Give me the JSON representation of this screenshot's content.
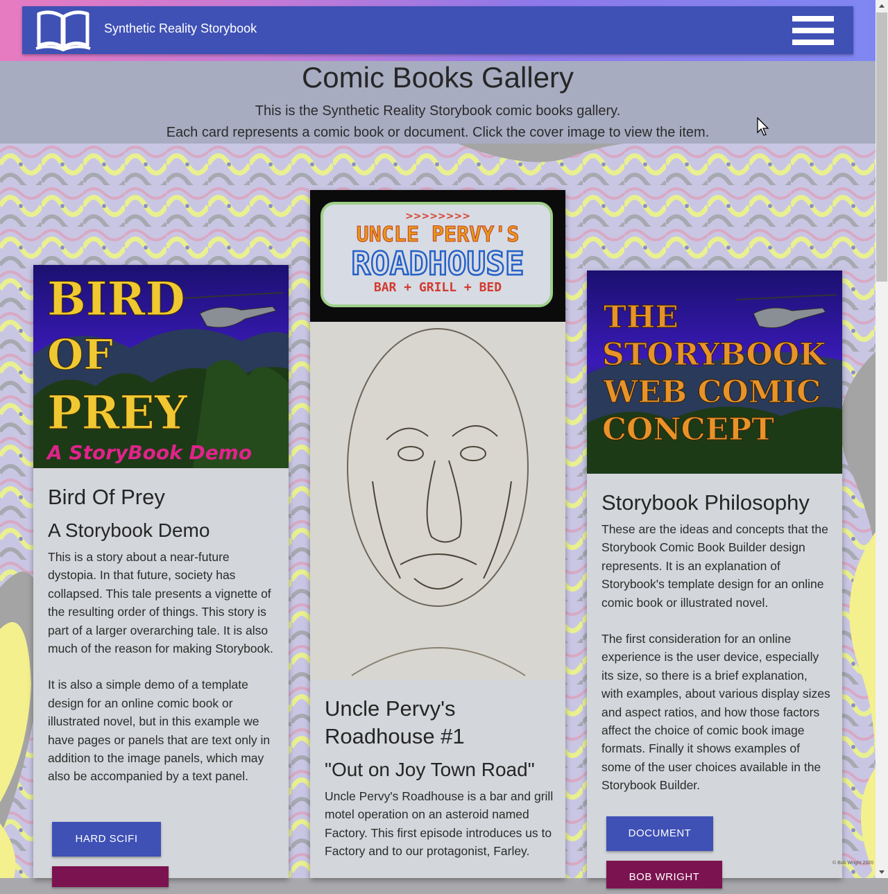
{
  "navbar": {
    "brand": "Synthetic Reality Storybook",
    "logo_icon": "open-book-icon",
    "menu_icon": "hamburger-menu-icon",
    "bg_color": "#3f51b5"
  },
  "header": {
    "title": "Comic Books Gallery",
    "line1": "This is the Synthetic Reality Storybook comic books gallery.",
    "line2": "Each card represents a comic book or document. Click the cover image to view the item."
  },
  "cards": [
    {
      "cover": {
        "line1": "BIRD",
        "line2": "OF",
        "line3": "PREY",
        "tagline": "A StoryBook Demo"
      },
      "title": "Bird Of Prey",
      "subtitle": "A Storybook Demo",
      "para1": "This is a story about a near-future dystopia. In that future, society has collapsed. This tale presents a vignette of the resulting order of things. This story is part of a larger overarching tale. It is also much of the reason for making Storybook.",
      "para2": "It is also a simple demo of a template design for an online comic book or illustrated novel, but in this example we have pages or panels that are text only in addition to the image panels, which may also be accompanied by a text panel.",
      "button1": "HARD  SCIFI",
      "button2": ""
    },
    {
      "cover": {
        "arrows": ">>>>>>>>",
        "line1": "UNCLE PERVY'S",
        "line2": "ROADHOUSE",
        "line3": "BAR + GRILL + BED"
      },
      "title": "Uncle Pervy's Roadhouse #1",
      "subtitle": "\"Out on Joy Town Road\"",
      "para1": "Uncle Pervy's Roadhouse is a bar and grill motel operation on an asteroid named Factory. This first episode introduces us to Factory and to our protagonist, Farley."
    },
    {
      "cover": {
        "line1": "THE",
        "line2": "STORYBOOK",
        "line3": "WEB COMIC",
        "line4": "CONCEPT"
      },
      "title": "Storybook Philosophy",
      "para1": "These are the ideas and concepts that the Storybook Comic Book Builder design represents. It is an explanation of Storybook's template design for an online comic book or illustrated novel.",
      "para2": "The first consideration for an online experience is the user device, especially its size, so there is a brief explanation, with examples, about various display sizes and aspect ratios, and how those factors affect the choice of comic book image formats. Finally it shows examples of some of the user choices available in the Storybook Builder.",
      "button1": "DOCUMENT",
      "button2": "BOB  WRIGHT"
    }
  ],
  "footer": {
    "copyright": "© Bob Wright 2020"
  },
  "colors": {
    "primary": "#3f51b5",
    "secondary": "#7b1350",
    "card_bg": "#d3d6da"
  }
}
